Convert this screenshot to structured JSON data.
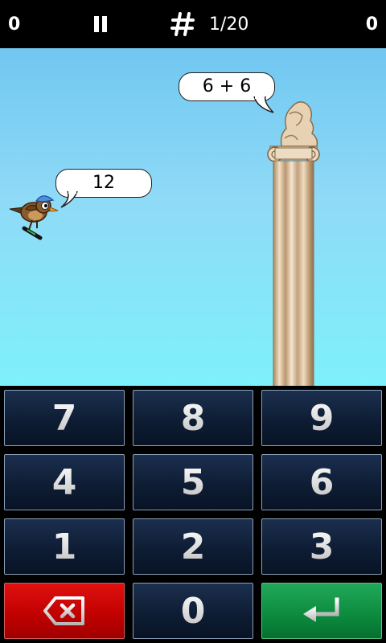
{
  "topbar": {
    "score_left": "0",
    "progress": "1/20",
    "score_right": "0",
    "pause_icon": "pause-icon",
    "count_icon": "hash-icon"
  },
  "scene": {
    "question": "6 + 6",
    "answer": "12"
  },
  "keypad": {
    "keys": [
      "7",
      "8",
      "9",
      "4",
      "5",
      "6",
      "1",
      "2",
      "3",
      "0"
    ],
    "backspace_icon": "backspace-icon",
    "enter_icon": "enter-icon"
  },
  "colors": {
    "sky_top": "#71c7f1",
    "sky_bottom": "#7ef1fb",
    "key_bg": "#0e1d34",
    "backspace_bg": "#c00000",
    "enter_bg": "#0c8a3e"
  }
}
